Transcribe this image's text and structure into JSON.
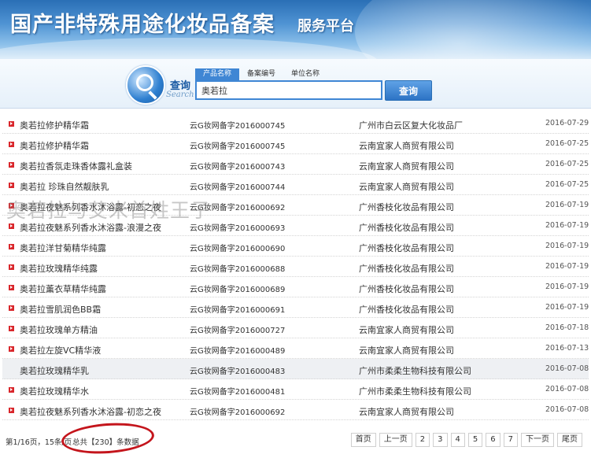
{
  "header": {
    "title": "国产非特殊用途化妆品备案",
    "subtitle": "服务平台"
  },
  "search": {
    "label_cn": "查询",
    "label_en": "Search",
    "tabs": [
      "产品名称",
      "备案编号",
      "单位名称"
    ],
    "active_tab": 0,
    "query": "奥若拉",
    "button_label": "查询"
  },
  "rows": [
    {
      "name": "奥若拉修护精华霜",
      "number": "云G妆网备字2016000745",
      "company": "广州市白云区复大化妆品厂",
      "date": "2016-07-29"
    },
    {
      "name": "奥若拉修护精华霜",
      "number": "云G妆网备字2016000745",
      "company": "云南宜家人商贸有限公司",
      "date": "2016-07-25"
    },
    {
      "name": "奥若拉香氛走珠香体露礼盒装",
      "number": "云G妆网备字2016000743",
      "company": "云南宜家人商贸有限公司",
      "date": "2016-07-25"
    },
    {
      "name": "奥若拉 珍珠自然靓肤乳",
      "number": "云G妆网备字2016000744",
      "company": "云南宜家人商贸有限公司",
      "date": "2016-07-25"
    },
    {
      "name": "奥若拉夜魅系列香水沐浴露-初恋之夜",
      "number": "云G妆网备字2016000692",
      "company": "广州香枝化妆品有限公司",
      "date": "2016-07-19"
    },
    {
      "name": "奥若拉夜魅系列香水沐浴露-浪漫之夜",
      "number": "云G妆网备字2016000693",
      "company": "广州香枝化妆品有限公司",
      "date": "2016-07-19"
    },
    {
      "name": "奥若拉洋甘菊精华纯露",
      "number": "云G妆网备字2016000690",
      "company": "广州香枝化妆品有限公司",
      "date": "2016-07-19"
    },
    {
      "name": "奥若拉玫瑰精华纯露",
      "number": "云G妆网备字2016000688",
      "company": "广州香枝化妆品有限公司",
      "date": "2016-07-19"
    },
    {
      "name": "奥若拉薰衣草精华纯露",
      "number": "云G妆网备字2016000689",
      "company": "广州香枝化妆品有限公司",
      "date": "2016-07-19"
    },
    {
      "name": "奥若拉雪肌润色BB霜",
      "number": "云G妆网备字2016000691",
      "company": "广州香枝化妆品有限公司",
      "date": "2016-07-19"
    },
    {
      "name": "奥若拉玫瑰单方精油",
      "number": "云G妆网备字2016000727",
      "company": "云南宜家人商贸有限公司",
      "date": "2016-07-18"
    },
    {
      "name": "奥若拉左旋VC精华液",
      "number": "云G妆网备字2016000489",
      "company": "云南宜家人商贸有限公司",
      "date": "2016-07-13"
    },
    {
      "name": "奥若拉玫瑰精华乳",
      "number": "云G妆网备字2016000483",
      "company": "广州市柔柔生物科技有限公司",
      "date": "2016-07-08",
      "highlight": true,
      "no_bullet": true
    },
    {
      "name": "奥若拉玫瑰精华水",
      "number": "云G妆网备字2016000481",
      "company": "广州市柔柔生物科技有限公司",
      "date": "2016-07-08"
    },
    {
      "name": "奥若拉夜魅系列香水沐浴露-初恋之夜",
      "number": "云G妆网备字2016000692",
      "company": "云南宜家人商贸有限公司",
      "date": "2016-07-08"
    }
  ],
  "watermark": "奥若拉与艾米首姓王子",
  "footer": {
    "page_info": "第1/16页，15条/页",
    "total_text": "总共【230】条数据",
    "pager": [
      "首页",
      "上一页",
      "2",
      "3",
      "4",
      "5",
      "6",
      "7",
      "下一页",
      "尾页"
    ]
  },
  "colors": {
    "accent": "#3f86d4",
    "bullet": "#d9262b",
    "annotation_circle": "#c4151c"
  }
}
